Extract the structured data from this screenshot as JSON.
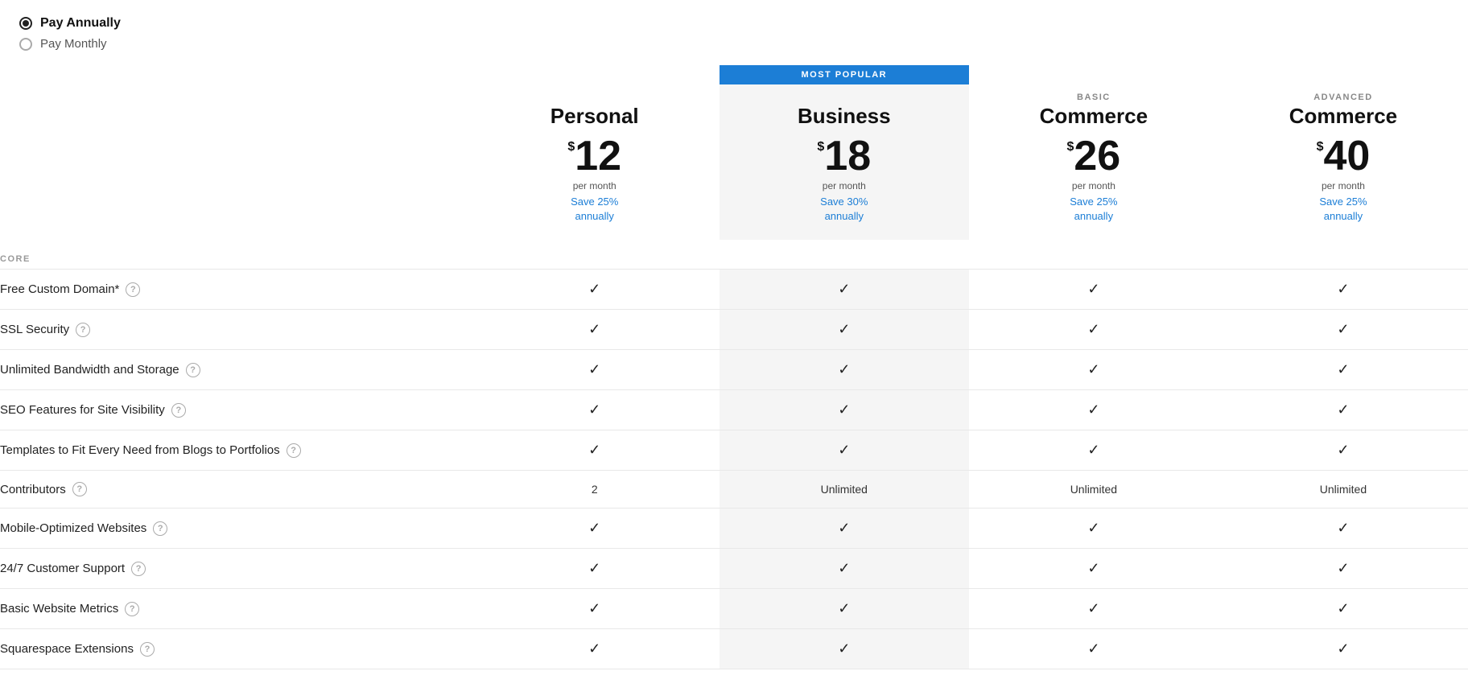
{
  "billing": {
    "annually_label": "Pay Annually",
    "monthly_label": "Pay Monthly",
    "annually_selected": true
  },
  "most_popular_badge": "MOST POPULAR",
  "plans": [
    {
      "id": "personal",
      "subtitle": "",
      "name": "Personal",
      "price": "12",
      "per_month": "per month",
      "save": "Save 25%\nannually",
      "is_popular": false
    },
    {
      "id": "business",
      "subtitle": "",
      "name": "Business",
      "price": "18",
      "per_month": "per month",
      "save": "Save 30%\nannually",
      "is_popular": true
    },
    {
      "id": "basic-commerce",
      "subtitle": "BASIC",
      "name": "Commerce",
      "price": "26",
      "per_month": "per month",
      "save": "Save 25%\nannually",
      "is_popular": false
    },
    {
      "id": "advanced-commerce",
      "subtitle": "ADVANCED",
      "name": "Commerce",
      "price": "40",
      "per_month": "per month",
      "save": "Save 25%\nannually",
      "is_popular": false
    }
  ],
  "section_label": "CORE",
  "features": [
    {
      "name": "Free Custom Domain*",
      "has_help": true,
      "values": [
        "check",
        "check",
        "check",
        "check"
      ]
    },
    {
      "name": "SSL Security",
      "has_help": true,
      "values": [
        "check",
        "check",
        "check",
        "check"
      ]
    },
    {
      "name": "Unlimited Bandwidth and Storage",
      "has_help": true,
      "values": [
        "check",
        "check",
        "check",
        "check"
      ]
    },
    {
      "name": "SEO Features for Site Visibility",
      "has_help": true,
      "values": [
        "check",
        "check",
        "check",
        "check"
      ]
    },
    {
      "name": "Templates to Fit Every Need from Blogs to Portfolios",
      "has_help": true,
      "values": [
        "check",
        "check",
        "check",
        "check"
      ]
    },
    {
      "name": "Contributors",
      "has_help": true,
      "values": [
        "2",
        "Unlimited",
        "Unlimited",
        "Unlimited"
      ]
    },
    {
      "name": "Mobile-Optimized Websites",
      "has_help": true,
      "values": [
        "check",
        "check",
        "check",
        "check"
      ]
    },
    {
      "name": "24/7 Customer Support",
      "has_help": true,
      "values": [
        "check",
        "check",
        "check",
        "check"
      ]
    },
    {
      "name": "Basic Website Metrics",
      "has_help": true,
      "values": [
        "check",
        "check",
        "check",
        "check"
      ]
    },
    {
      "name": "Squarespace Extensions",
      "has_help": true,
      "values": [
        "check",
        "check",
        "check",
        "check"
      ]
    }
  ],
  "icons": {
    "checkmark": "✓",
    "help": "?",
    "bullet_filled": "●",
    "bullet_empty": "○"
  }
}
